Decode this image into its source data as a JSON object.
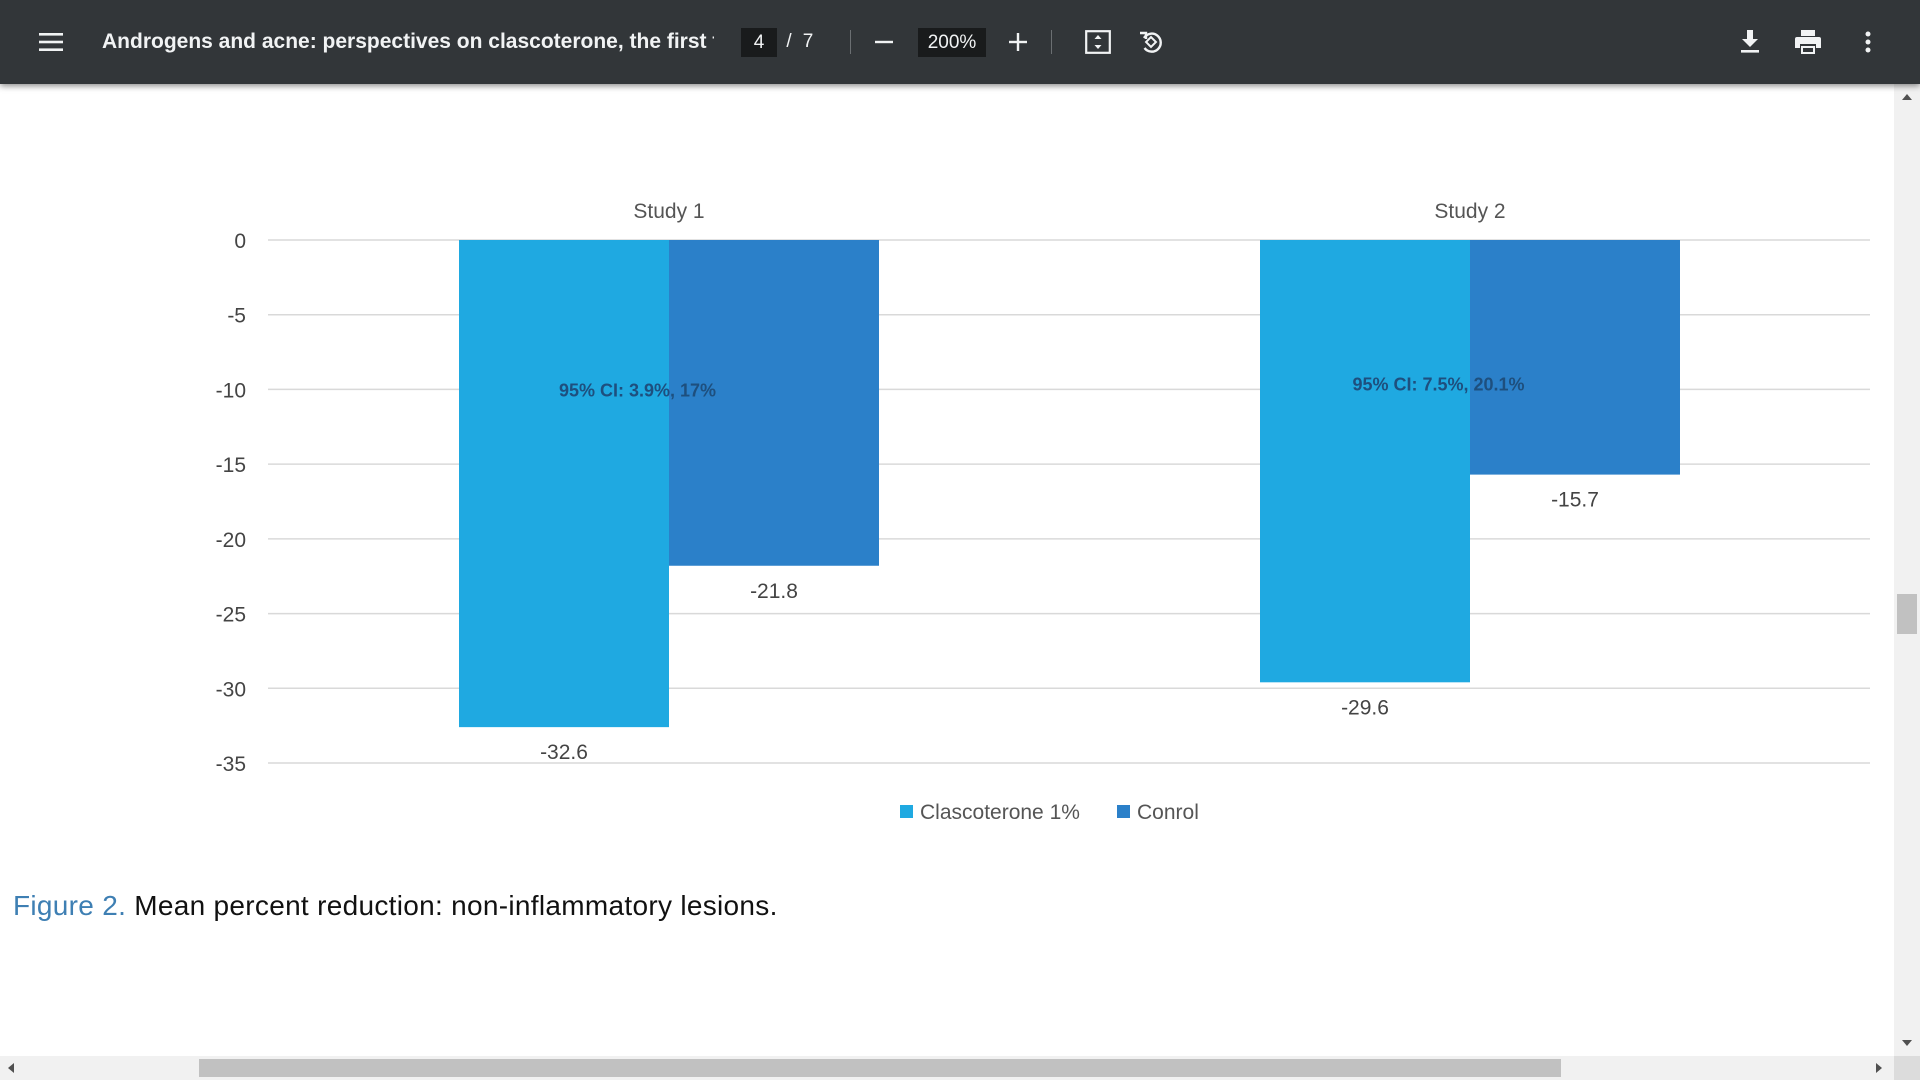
{
  "toolbar": {
    "menu_icon": "hamburger-menu-icon",
    "title": "Androgens and acne: perspectives on clascoterone, the first top...",
    "page_current": "4",
    "page_separator": "/",
    "page_total": "7",
    "zoom_out_icon": "minus-icon",
    "zoom_level": "200%",
    "zoom_in_icon": "plus-icon",
    "fit_icon": "fit-to-page-icon",
    "rotate_icon": "rotate-counterclockwise-icon",
    "download_icon": "download-icon",
    "print_icon": "print-icon",
    "more_icon": "more-vertical-icon",
    "background_color": "#323639"
  },
  "chart_data": {
    "type": "bar",
    "categories": [
      "Study 1",
      "Study 2"
    ],
    "series": [
      {
        "name": "Clascoterone 1%",
        "values": [
          -32.6,
          -29.6
        ],
        "color": "#1fa9e1"
      },
      {
        "name": "Conrol",
        "values": [
          -21.8,
          -15.7
        ],
        "color": "#2b80c9"
      }
    ],
    "data_labels": [
      [
        "-32.6",
        "-21.8"
      ],
      [
        "-29.6",
        "-15.7"
      ]
    ],
    "annotations": [
      "95% CI: 3.9%, 17%",
      "95% CI: 7.5%, 20.1%"
    ],
    "yticks": [
      0,
      -5,
      -10,
      -15,
      -20,
      -25,
      -30,
      -35
    ],
    "ylim": [
      -35,
      0
    ],
    "xlabel": "",
    "ylabel": "",
    "grid": true,
    "category_label_position": "top",
    "legend_position": "bottom-center"
  },
  "caption": {
    "label": "Figure 2.",
    "text": "Mean percent reduction: non-inflammatory lesions."
  }
}
